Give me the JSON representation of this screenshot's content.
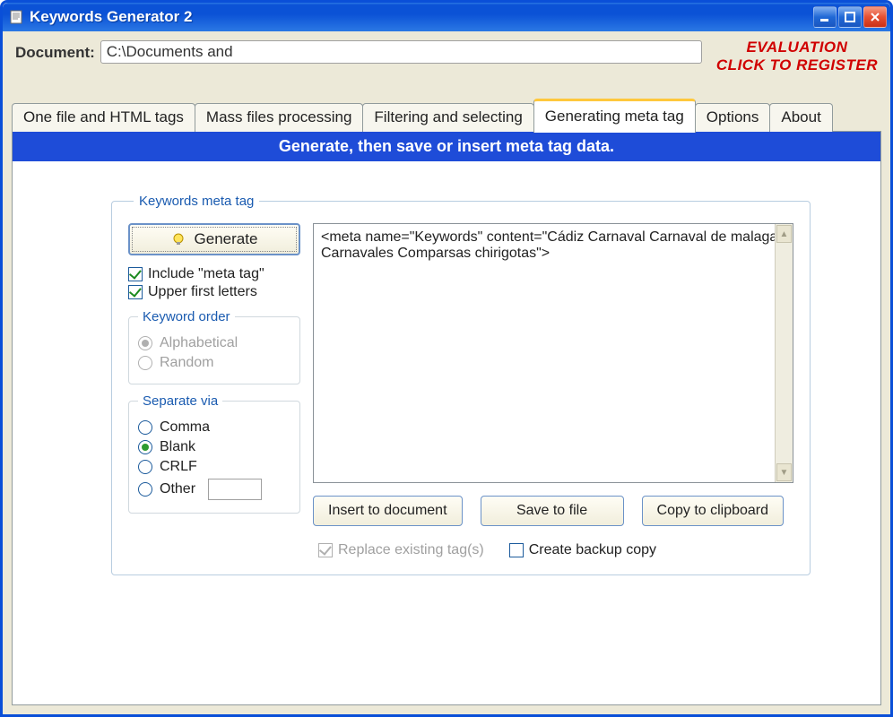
{
  "title": "Keywords Generator 2",
  "doc_label": "Document:",
  "doc_path": "C:\\Documents and",
  "eval_line1": "EVALUATION",
  "eval_line2": "CLICK TO REGISTER",
  "tabs": {
    "t0": "One file and HTML tags",
    "t1": "Mass files processing",
    "t2": "Filtering and selecting",
    "t3": "Generating meta tag",
    "t4": "Options",
    "t5": "About"
  },
  "bluebar": "Generate, then save or insert meta tag data.",
  "groupbox_title": "Keywords meta tag",
  "generate_btn": "Generate",
  "chk_include": "Include \"meta tag\"",
  "chk_upper": "Upper first letters",
  "keyword_order_title": "Keyword order",
  "radio_alpha": "Alphabetical",
  "radio_random": "Random",
  "separate_title": "Separate via",
  "radio_comma": "Comma",
  "radio_blank": "Blank",
  "radio_crlf": "CRLF",
  "radio_other": "Other",
  "output_text": "<meta name=\"Keywords\" content=\"Cádiz Carnaval Carnaval de malaga Carnavales Comparsas chirigotas\">",
  "btn_insert": "Insert to document",
  "btn_save": "Save to file",
  "btn_copy": "Copy to clipboard",
  "chk_replace": "Replace existing tag(s)",
  "chk_backup": "Create backup copy",
  "other_value": ""
}
